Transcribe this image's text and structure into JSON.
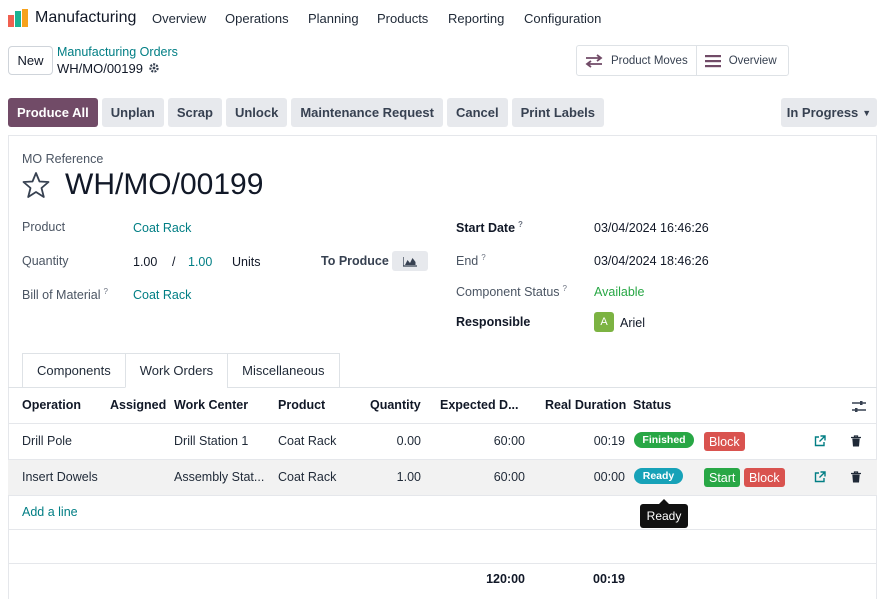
{
  "app": {
    "name": "Manufacturing"
  },
  "menu": [
    "Overview",
    "Operations",
    "Planning",
    "Products",
    "Reporting",
    "Configuration"
  ],
  "control": {
    "new_label": "New",
    "breadcrumb_parent": "Manufacturing Orders",
    "breadcrumb_current": "WH/MO/00199",
    "smart_buttons": [
      "Product Moves",
      "Overview"
    ]
  },
  "statusbar": {
    "buttons": [
      "Produce All",
      "Unplan",
      "Scrap",
      "Unlock",
      "Maintenance Request",
      "Cancel",
      "Print Labels"
    ],
    "state": "In Progress"
  },
  "form": {
    "ref_label": "MO Reference",
    "ref_value": "WH/MO/00199",
    "product_label": "Product",
    "product_value": "Coat Rack",
    "quantity_label": "Quantity",
    "quantity_produced": "1.00",
    "quantity_sep": "/",
    "quantity_total": "1.00",
    "quantity_uom": "Units",
    "to_produce_label": "To Produce",
    "bom_label": "Bill of Material",
    "bom_value": "Coat Rack",
    "start_label": "Start Date",
    "start_value": "03/04/2024 16:46:26",
    "end_label": "End",
    "end_value": "03/04/2024 18:46:26",
    "component_status_label": "Component Status",
    "component_status_value": "Available",
    "responsible_label": "Responsible",
    "responsible_initial": "A",
    "responsible_name": "Ariel",
    "help_mark": "?"
  },
  "tabs": [
    "Components",
    "Work Orders",
    "Miscellaneous"
  ],
  "table": {
    "headers": [
      "Operation",
      "Assigned",
      "Work Center",
      "Product",
      "Quantity",
      "Expected D...",
      "Real Duration",
      "Status"
    ],
    "rows": [
      {
        "operation": "Drill Pole",
        "assigned": "",
        "work_center": "Drill Station 1",
        "product": "Coat Rack",
        "quantity": "0.00",
        "expected": "60:00",
        "real": "00:19",
        "status": "Finished",
        "actions": [
          "Block"
        ]
      },
      {
        "operation": "Insert Dowels",
        "assigned": "",
        "work_center": "Assembly Stat...",
        "product": "Coat Rack",
        "quantity": "1.00",
        "expected": "60:00",
        "real": "00:00",
        "status": "Ready",
        "actions": [
          "Start",
          "Block"
        ]
      }
    ],
    "add_line": "Add a line",
    "totals": {
      "expected": "120:00",
      "real": "00:19"
    },
    "tooltip": "Ready"
  },
  "colors": {
    "primary": "#714b67",
    "link": "#017e84",
    "finished": "#28a745",
    "ready": "#17a2b8",
    "block": "#d9534f"
  }
}
